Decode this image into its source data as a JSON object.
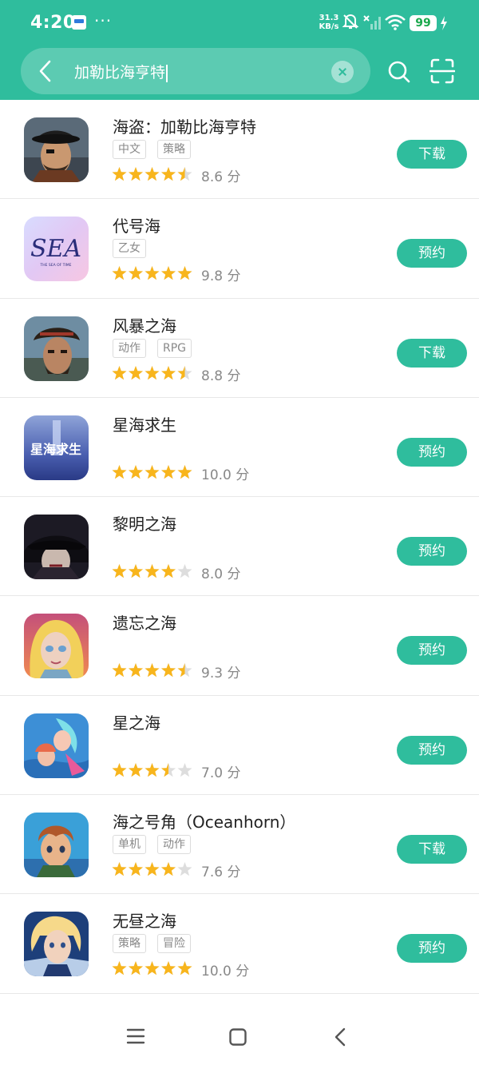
{
  "status_bar": {
    "time": "4:20",
    "dots": "···",
    "net_speed_value": "31.3",
    "net_speed_unit": "KB/s",
    "battery": "99"
  },
  "search": {
    "query": "加勒比海亨特",
    "back_icon": "back-arrow-icon",
    "clear_icon": "clear-icon",
    "search_icon": "search-icon",
    "scan_icon": "scan-icon"
  },
  "results": [
    {
      "title": "海盗：加勒比海亨特",
      "tags": [
        "中文",
        "策略"
      ],
      "rating": 4.5,
      "score": "8.6 分",
      "action": "下载"
    },
    {
      "title": "代号海",
      "tags": [
        "乙女"
      ],
      "rating": 5,
      "score": "9.8 分",
      "action": "预约"
    },
    {
      "title": "风暴之海",
      "tags": [
        "动作",
        "RPG"
      ],
      "rating": 4.5,
      "score": "8.8 分",
      "action": "下载"
    },
    {
      "title": "星海求生",
      "tags": [],
      "rating": 5,
      "score": "10.0 分",
      "action": "预约"
    },
    {
      "title": " 黎明之海",
      "tags": [],
      "rating": 4,
      "score": "8.0 分",
      "action": "预约"
    },
    {
      "title": "遗忘之海",
      "tags": [],
      "rating": 4.5,
      "score": "9.3 分",
      "action": "预约"
    },
    {
      "title": "星之海",
      "tags": [],
      "rating": 3.5,
      "score": "7.0 分",
      "action": "预约"
    },
    {
      "title": "海之号角（Oceanhorn）",
      "tags": [
        "单机",
        "动作"
      ],
      "rating": 4,
      "score": "7.6 分",
      "action": "下载"
    },
    {
      "title": "无昼之海",
      "tags": [
        "策略",
        "冒险"
      ],
      "rating": 5,
      "score": "10.0 分",
      "action": "预约"
    }
  ],
  "icon_art": {
    "sea_logo": "SEA",
    "sea_subtitle": "THE SEA OF TIME",
    "survival_logo": "星海求生"
  },
  "colors": {
    "accent": "#2fbd9d",
    "star": "#f8b51c",
    "star_empty": "#dddddd"
  },
  "navbar": {
    "menu_icon": "menu-icon",
    "home_icon": "home-icon",
    "back_icon": "back-icon"
  }
}
